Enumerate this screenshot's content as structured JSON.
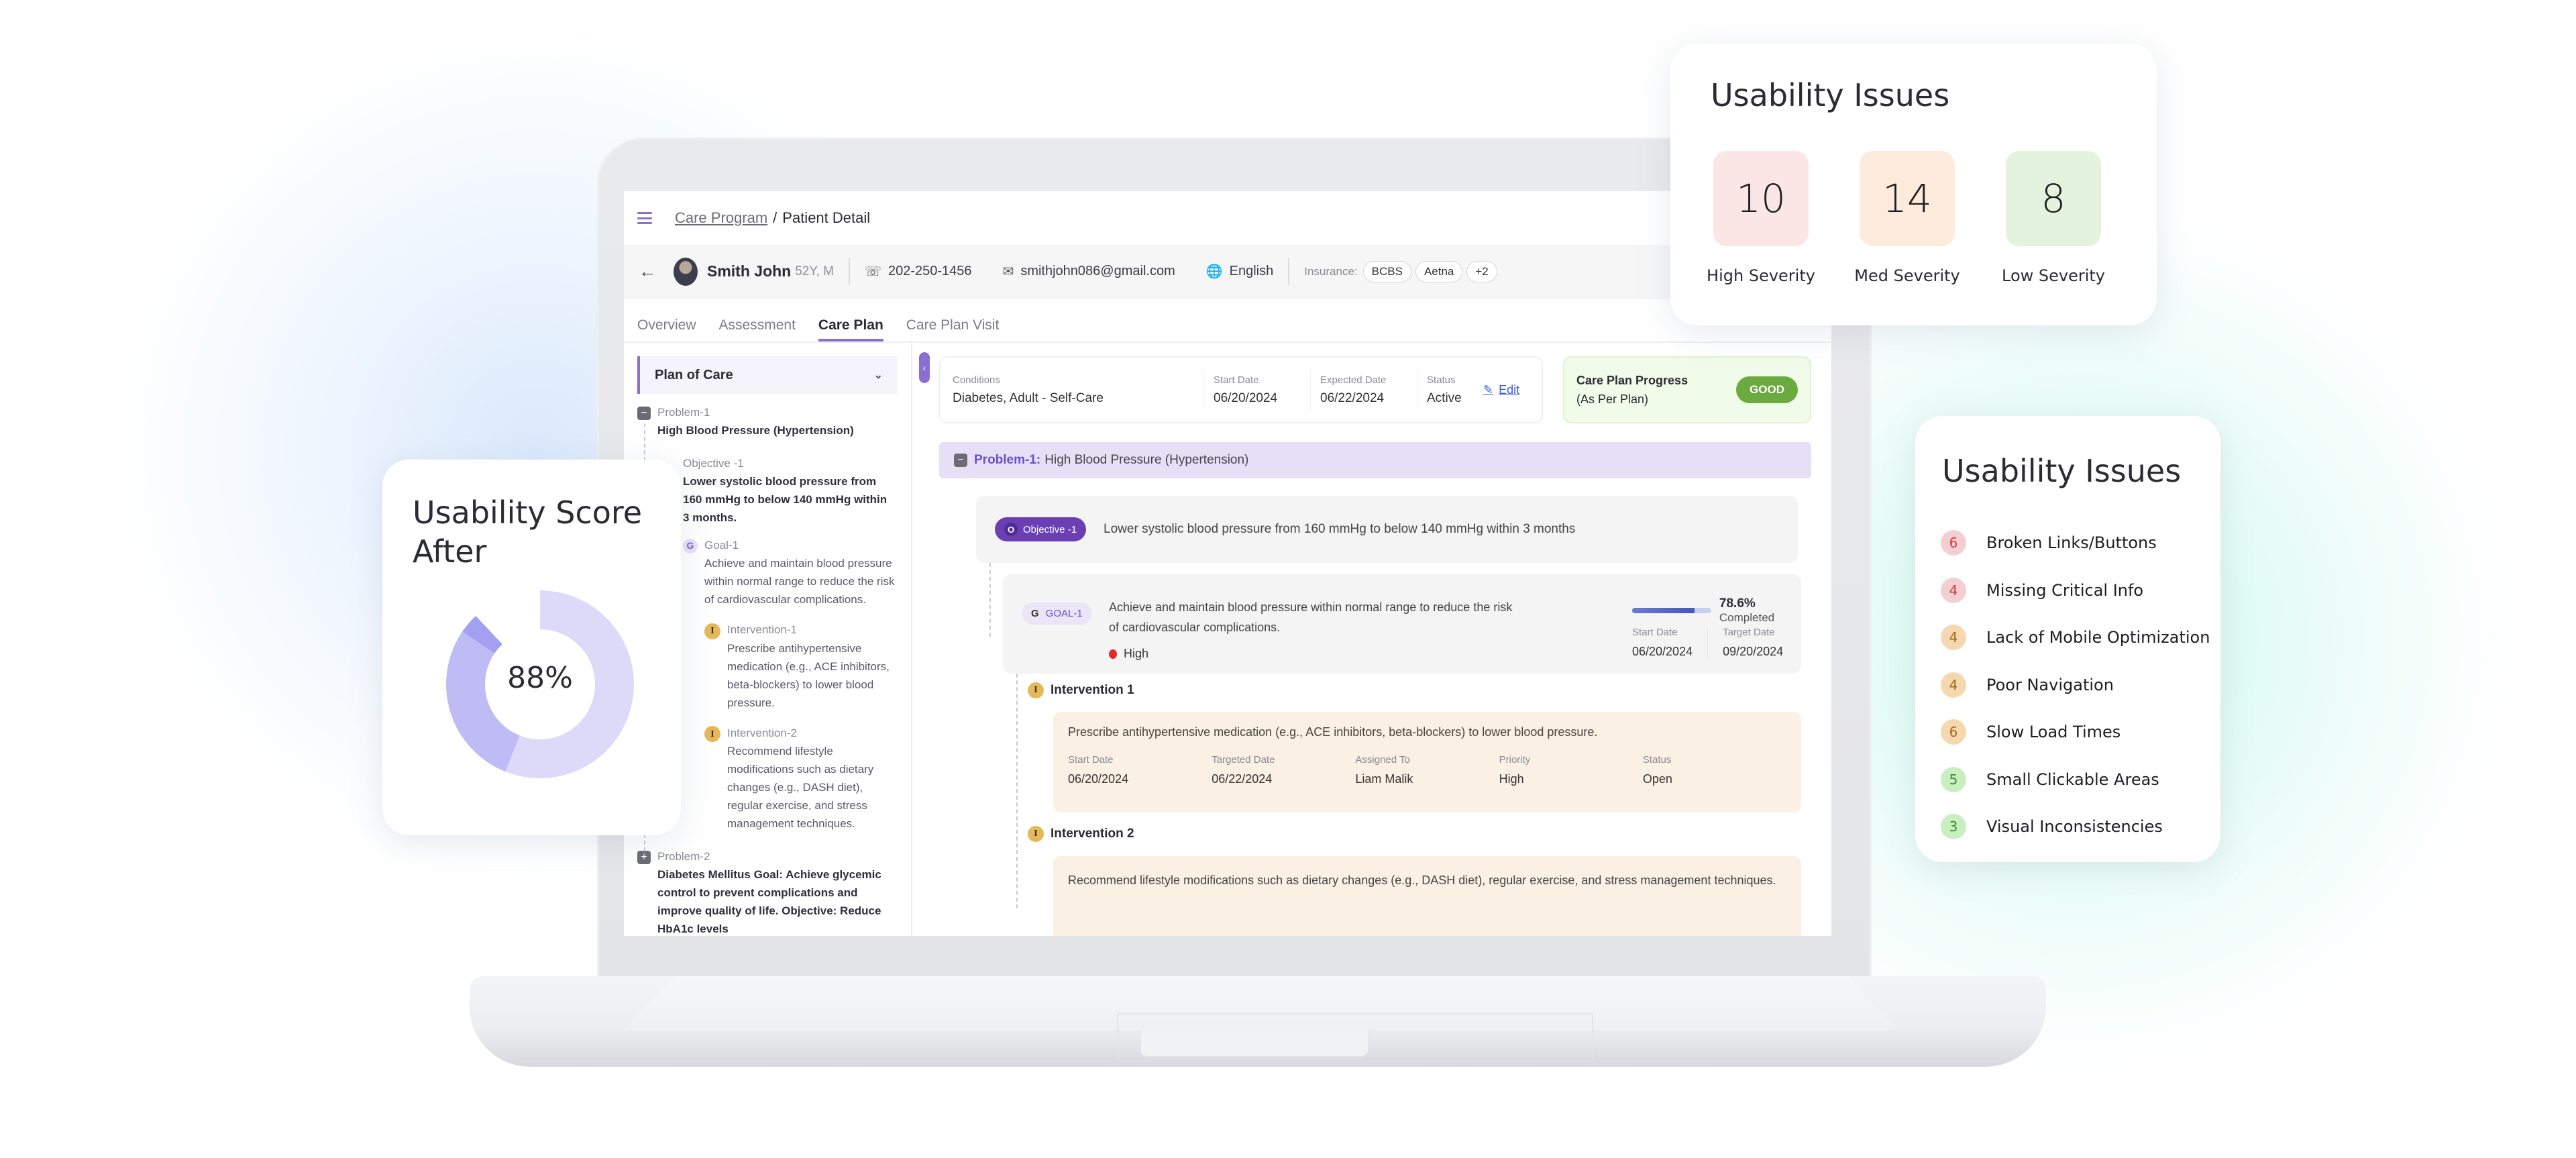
{
  "app": {
    "breadcrumb": {
      "parent": "Care Program",
      "separator": "/",
      "current": "Patient Detail"
    },
    "patient": {
      "name": "Smith John",
      "meta": "52Y, M",
      "phone": "202-250-1456",
      "email": "smithjohn086@gmail.com",
      "language": "English",
      "insurance_label": "Insurance:",
      "insurance_chips": [
        "BCBS",
        "Aetna",
        "+2"
      ]
    },
    "tabs": [
      {
        "label": "Overview",
        "active": false
      },
      {
        "label": "Assessment",
        "active": false
      },
      {
        "label": "Care Plan",
        "active": true
      },
      {
        "label": "Care Plan Visit",
        "active": false
      }
    ],
    "sidebar": {
      "dropdown_label": "Plan of Care",
      "problem1": {
        "label": "Problem-1",
        "title": "High Blood Pressure (Hypertension)"
      },
      "objective1": {
        "label": "Objective -1",
        "text": "Lower systolic blood pressure from 160 mmHg to below 140 mmHg within 3 months."
      },
      "goal1": {
        "badge": "G",
        "label": "Goal-1",
        "text": "Achieve and maintain blood pressure within normal range to reduce the risk of cardiovascular complications."
      },
      "intervention1": {
        "badge": "I",
        "label": "Intervention-1",
        "text": "Prescribe antihypertensive medication (e.g., ACE inhibitors, beta-blockers) to lower blood pressure."
      },
      "intervention2": {
        "badge": "I",
        "label": "Intervention-2",
        "text": "Recommend lifestyle modifications such as dietary changes (e.g., DASH diet), regular exercise, and stress management techniques."
      },
      "problem2": {
        "label": "Problem-2",
        "text": "Diabetes Mellitus Goal: Achieve glycemic control to prevent complications and improve quality of life. Objective: Reduce HbA1c levels"
      }
    },
    "conditions": {
      "conditions_label": "Conditions",
      "conditions_value": "Diabetes, Adult - Self-Care",
      "start_label": "Start Date",
      "start_value": "06/20/2024",
      "expected_label": "Expected Date",
      "expected_value": "06/22/2024",
      "status_label": "Status",
      "status_value": "Active",
      "edit_label": "Edit"
    },
    "progress": {
      "title": "Care Plan Progress",
      "subtitle": "(As Per Plan)",
      "badge": "GOOD"
    },
    "problem_bar": {
      "label": "Problem-1:",
      "title": "High Blood Pressure (Hypertension)"
    },
    "objective": {
      "badge_letter": "O",
      "badge_label": "Objective -1",
      "text": "Lower systolic blood pressure from 160 mmHg to below 140 mmHg within 3 months"
    },
    "goal": {
      "badge_letter": "G",
      "badge_label": "GOAL-1",
      "text": "Achieve and maintain blood pressure within normal range to reduce the risk of cardiovascular complications.",
      "priority": "High",
      "completion_percent": 78.6,
      "completion_text": "78.6%",
      "completion_suffix": "Completed",
      "start_label": "Start Date",
      "start_value": "06/20/2024",
      "target_label": "Target Date",
      "target_value": "09/20/2024"
    },
    "interventions": [
      {
        "badge": "I",
        "title": "Intervention 1",
        "text": "Prescribe antihypertensive medication (e.g., ACE inhibitors, beta-blockers) to lower blood pressure.",
        "fields": [
          {
            "label": "Start Date",
            "value": "06/20/2024"
          },
          {
            "label": "Targeted  Date",
            "value": "06/22/2024"
          },
          {
            "label": "Assigned To",
            "value": "Liam Malik"
          },
          {
            "label": "Priority",
            "value": "High"
          },
          {
            "label": "Status",
            "value": "Open"
          }
        ]
      },
      {
        "badge": "I",
        "title": "Intervention 2",
        "text": "Recommend lifestyle modifications such as dietary changes (e.g., DASH diet), regular exercise, and stress management techniques."
      }
    ]
  },
  "score_card": {
    "title": "Usability Score After",
    "value_label": "88%",
    "segments": [
      {
        "name": "light",
        "fraction": 0.56,
        "color": "#dcdaf8"
      },
      {
        "name": "medium",
        "fraction": 0.285,
        "color": "#bfbcf5"
      },
      {
        "name": "dark",
        "fraction": 0.035,
        "color": "#a3a0f2"
      }
    ]
  },
  "severity_card": {
    "title": "Usability Issues",
    "items": [
      {
        "count": "10",
        "label": "High Severity",
        "color": "#fbe6e6"
      },
      {
        "count": "14",
        "label": "Med Severity",
        "color": "#fdecdc"
      },
      {
        "count": "8",
        "label": "Low Severity",
        "color": "#e4f3dd"
      }
    ]
  },
  "issues_card": {
    "title": "Usability Issues",
    "items": [
      {
        "count": "6",
        "label": "Broken Links/Buttons",
        "bg": "#f3cfd2",
        "fg": "#d23a3a"
      },
      {
        "count": "4",
        "label": "Missing Critical Info",
        "bg": "#f3cfd2",
        "fg": "#d23a3a"
      },
      {
        "count": "4",
        "label": "Lack of Mobile Optimization",
        "bg": "#f5d8b0",
        "fg": "#a5691e"
      },
      {
        "count": "4",
        "label": "Poor Navigation",
        "bg": "#f5d8b0",
        "fg": "#a5691e"
      },
      {
        "count": "6",
        "label": "Slow Load Times",
        "bg": "#f5d8b0",
        "fg": "#a5691e"
      },
      {
        "count": "5",
        "label": "Small Clickable Areas",
        "bg": "#c9efc0",
        "fg": "#3d8a2e"
      },
      {
        "count": "3",
        "label": "Visual Inconsistencies",
        "bg": "#c9efc0",
        "fg": "#3d8a2e"
      }
    ]
  }
}
